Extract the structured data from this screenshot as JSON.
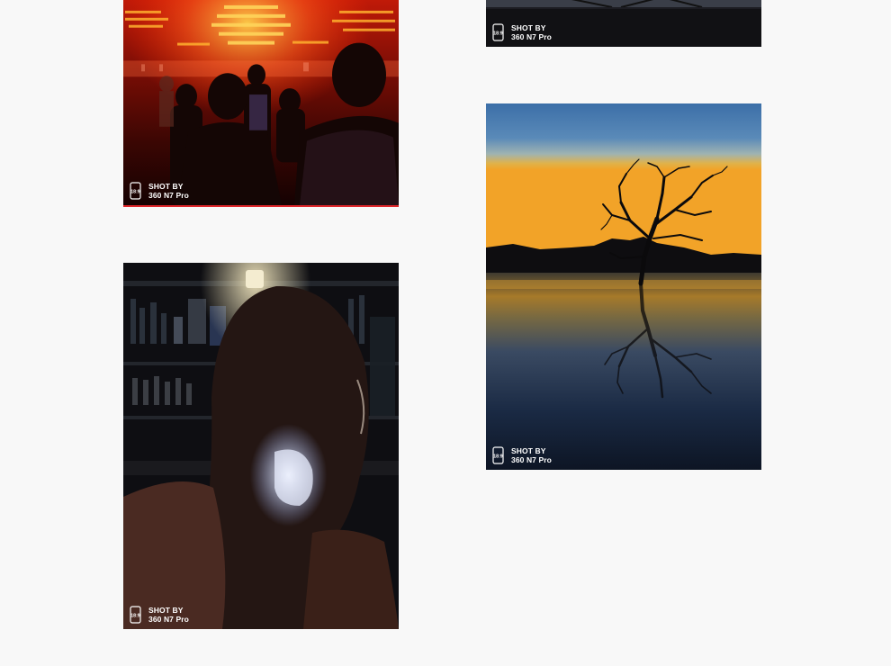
{
  "gallery": {
    "photos": [
      {
        "id": "nightlife",
        "watermark": {
          "line1": "SHOT BY",
          "line2": "360 N7 Pro",
          "ratio": "18:9"
        }
      },
      {
        "id": "top-right",
        "watermark": {
          "line1": "SHOT BY",
          "line2": "360 N7 Pro",
          "ratio": "18:9"
        }
      },
      {
        "id": "tree",
        "watermark": {
          "line1": "SHOT BY",
          "line2": "360 N7 Pro",
          "ratio": "18:9"
        }
      },
      {
        "id": "girl",
        "watermark": {
          "line1": "SHOT BY",
          "line2": "360 N7 Pro",
          "ratio": "18:9"
        }
      }
    ]
  },
  "colors": {
    "background": "#f8f8f8",
    "accent_border": "#e0262b",
    "watermark_text": "#ffffff"
  },
  "icons": {
    "watermark_icon": "phone-ratio-icon"
  }
}
